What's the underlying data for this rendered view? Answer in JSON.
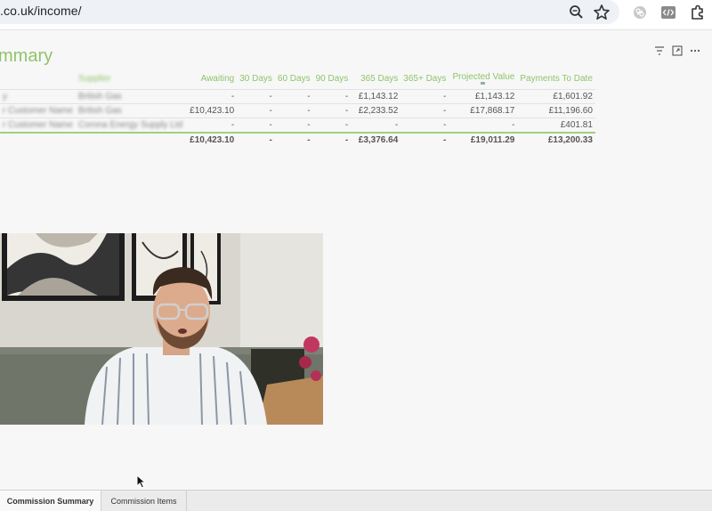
{
  "browser": {
    "url": ".co.uk/income/",
    "icons": [
      "zoom-icon",
      "bookmark-star-icon",
      "extension-link-icon",
      "extension-code-icon",
      "extensions-puzzle-icon"
    ]
  },
  "report": {
    "title": "mmary",
    "panel_icons": [
      "filter-icon",
      "expand-icon",
      "more-icon"
    ],
    "columns": {
      "col1": "",
      "col2": "Supplier",
      "awaiting": "Awaiting",
      "d30": "30 Days",
      "d60": "60 Days",
      "d90": "90 Days",
      "d365": "365 Days",
      "d365plus": "365+ Days",
      "projected": "Projected Value",
      "payments": "Payments To Date"
    },
    "rows": [
      {
        "col1": "y",
        "col2": "British Gas",
        "awaiting": "-",
        "d30": "-",
        "d60": "-",
        "d90": "-",
        "d365": "£1,143.12",
        "d365plus": "-",
        "projected": "£1,143.12",
        "payments": "£1,601.92"
      },
      {
        "col1": "r Customer Name",
        "col2": "British Gas",
        "awaiting": "£10,423.10",
        "d30": "-",
        "d60": "-",
        "d90": "-",
        "d365": "£2,233.52",
        "d365plus": "-",
        "projected": "£17,868.17",
        "payments": "£11,196.60"
      },
      {
        "col1": "r Customer Name",
        "col2": "Corona Energy Supply Ltd",
        "awaiting": "-",
        "d30": "-",
        "d60": "-",
        "d90": "-",
        "d365": "-",
        "d365plus": "-",
        "projected": "-",
        "payments": "£401.81"
      }
    ],
    "total": {
      "col1": "",
      "col2": "",
      "awaiting": "£10,423.10",
      "d30": "-",
      "d60": "-",
      "d90": "-",
      "d365": "£3,376.64",
      "d365plus": "-",
      "projected": "£19,011.29",
      "payments": "£13,200.33"
    }
  },
  "video": {
    "description_icon": "webcam-presenter"
  },
  "tabs": {
    "summary": "Commission Summary",
    "items": "Commission Items"
  },
  "colors": {
    "accent": "#8fc46a",
    "total_border": "#9fd07e"
  }
}
